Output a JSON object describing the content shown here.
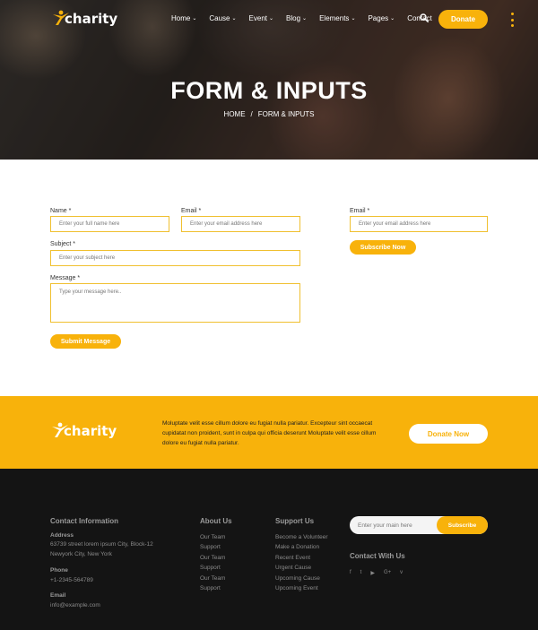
{
  "brand": {
    "name": "charity",
    "accent": "#f8b20b"
  },
  "nav": {
    "items": [
      {
        "label": "Home",
        "chevron": true
      },
      {
        "label": "Cause",
        "chevron": true
      },
      {
        "label": "Event",
        "chevron": true
      },
      {
        "label": "Blog",
        "chevron": true
      },
      {
        "label": "Elements",
        "chevron": true
      },
      {
        "label": "Pages",
        "chevron": true
      },
      {
        "label": "Contact",
        "chevron": false
      }
    ],
    "donate_label": "Donate",
    "search_icon": "search-icon",
    "menu_icon": "vertical-dots-icon"
  },
  "hero": {
    "title": "FORM & INPUTS",
    "breadcrumb": {
      "home": "HOME",
      "separator": "/",
      "current": "FORM & INPUTS"
    }
  },
  "form": {
    "name_label": "Name *",
    "name_placeholder": "Enter your full name here",
    "email_label": "Email *",
    "email_placeholder": "Enter your email address here",
    "subject_label": "Subject *",
    "subject_placeholder": "Enter your subject here",
    "message_label": "Message *",
    "message_placeholder": "Type your message here..",
    "submit_label": "Submit Message"
  },
  "subscribe": {
    "email_label": "Email *",
    "email_placeholder": "Enter your email address here",
    "button_label": "Subscribe Now"
  },
  "cta": {
    "logo_text": "charity",
    "text": "Moluptate velit esse cillum dolore eu fugiat nulla pariatur. Excepteur sint occaecat cupidatat non proident, sunt in culpa qui officia deserunt Moluptate velit esse cillum dolore eu fugiat nulla pariatur.",
    "button_label": "Donate Now"
  },
  "footer": {
    "contact": {
      "heading": "Contact Information",
      "address_label": "Address",
      "address_line1": "63739 street lorem ipsum City, Block-12",
      "address_line2": "Newyork City, New York",
      "phone_label": "Phone",
      "phone": "+1-2345-564789",
      "email_label": "Email",
      "email": "info@example.com"
    },
    "about": {
      "heading": "About Us",
      "links": [
        "Our Team",
        "Support",
        "Our Team",
        "Support",
        "Our Team",
        "Support"
      ]
    },
    "support": {
      "heading": "Support Us",
      "links": [
        "Become a Volunteer",
        "Make a Donation",
        "Recent Event",
        "Urgent Cause",
        "Upcoming Cause",
        "Upcoming Event"
      ]
    },
    "newsletter": {
      "placeholder": "Enter your main here",
      "button_label": "Subscribe"
    },
    "social": {
      "heading": "Contact With Us",
      "icons": [
        {
          "name": "facebook-icon",
          "glyph": "f"
        },
        {
          "name": "twitter-icon",
          "glyph": "t"
        },
        {
          "name": "youtube-icon",
          "glyph": "▶"
        },
        {
          "name": "google-plus-icon",
          "glyph": "G+"
        },
        {
          "name": "vimeo-icon",
          "glyph": "v"
        }
      ]
    }
  }
}
